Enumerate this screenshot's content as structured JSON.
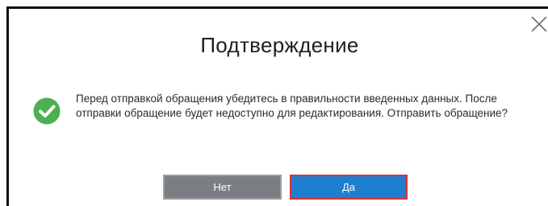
{
  "dialog": {
    "title": "Подтверждение",
    "message": "Перед отправкой обращения убедитесь в правильности введенных данных. После отправки обращение будет недоступно для редактирования. Отправить обращение?",
    "buttons": {
      "no_label": "Нет",
      "yes_label": "Да"
    },
    "icons": {
      "status": "check-circle-icon",
      "close": "close-icon"
    },
    "colors": {
      "success_icon": "#4caf50",
      "button_no": "#7b7f84",
      "button_yes": "#1e7ecf",
      "button_yes_focus_border": "#d93333"
    }
  }
}
